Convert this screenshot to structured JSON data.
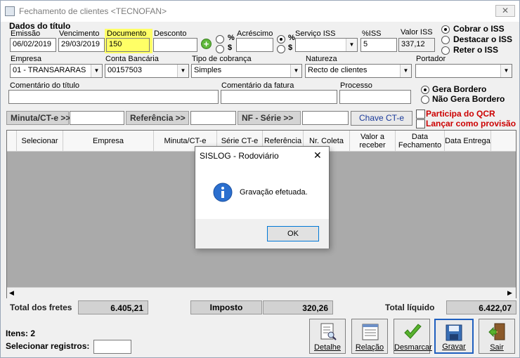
{
  "window": {
    "title": "Fechamento de clientes <TECNOFAN>",
    "close": "✕"
  },
  "section": "Dados do título",
  "fields": {
    "emissao_label": "Emissão",
    "emissao": "06/02/2019",
    "vencimento_label": "Vencimento",
    "vencimento": "29/03/2019",
    "documento_label": "Documento",
    "documento": "150",
    "desconto_label": "Desconto",
    "desconto": "",
    "acrescimo_label": "Acréscimo",
    "acrescimo": "",
    "servico_label": "Serviço ISS",
    "servico": "",
    "pct_iss_label": "%ISS",
    "pct_iss": "5",
    "valor_iss_label": "Valor ISS",
    "valor_iss": "337,12",
    "empresa_label": "Empresa",
    "empresa": "01 - TRANSARARAS",
    "conta_label": "Conta Bancária",
    "conta": "00157503",
    "tipo_label": "Tipo de cobrança",
    "tipo": "Simples",
    "natureza_label": "Natureza",
    "natureza": "Recto de clientes",
    "portador_label": "Portador",
    "portador": "",
    "comentario_titulo_label": "Comentário do título",
    "comentario_fatura_label": "Comentário da fatura",
    "processo_label": "Processo",
    "pct_symbol": "%",
    "dollar_symbol": "$"
  },
  "iss_options": [
    "Cobrar o ISS",
    "Destacar o ISS",
    "Reter o ISS"
  ],
  "bordero_options": [
    "Gera Bordero",
    "Não Gera Bordero"
  ],
  "filters": {
    "minuta": "Minuta/CT-e >>",
    "referencia": "Referência >>",
    "nf_serie": "NF - Série >>",
    "chave": "Chave CT-e",
    "participa": "Participa do QCR",
    "lancar": "Lançar como provisão"
  },
  "grid_headers": [
    "Selecionar",
    "Empresa",
    "Minuta/CT-e",
    "Série CT-e",
    "Referência",
    "Nr. Coleta",
    "Valor a receber",
    "Data Fechamento",
    "Data Entrega"
  ],
  "totals": {
    "fretes_label": "Total dos fretes",
    "fretes": "6.405,21",
    "imposto_label": "Imposto",
    "imposto": "320,26",
    "liquido_label": "Total líquido",
    "liquido": "6.422,07"
  },
  "footer": {
    "itens": "Itens: 2",
    "selecionar": "Selecionar registros:"
  },
  "toolbar": [
    "Detalhe",
    "Relação",
    "Desmarcar",
    "Gravar",
    "Sair"
  ],
  "dialog": {
    "title": "SISLOG - Rodoviário",
    "message": "Gravação efetuada.",
    "ok": "OK",
    "close": "✕"
  },
  "colors": {
    "highlight": "#ffff66",
    "red_text": "#cc0000",
    "link_blue": "#1a3a9a"
  }
}
